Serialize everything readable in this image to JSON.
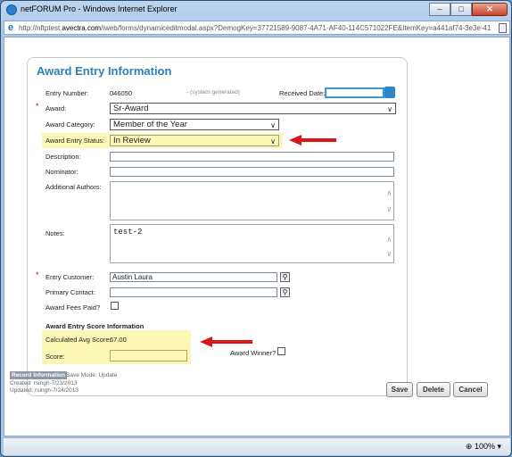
{
  "window": {
    "title": "netFORUM Pro - Windows Internet Explorer",
    "minimize": "–",
    "maximize": "□",
    "close": "✕"
  },
  "address": {
    "prefix": "http://nftptest.",
    "domain": "avectra.com",
    "path": "/iweb/forms/dynamiceditmodal.aspx?DemogKey=37721589-9087-4A71-AF40-114C571022FE&ItemKey=a441af74-3e3e-41"
  },
  "form": {
    "title": "Award Entry Information",
    "entry_number_label": "Entry Number:",
    "entry_number": "046050",
    "system_generated": "- (system generated)",
    "received_date_label": "Received Date:",
    "received_date": "",
    "award_label": "Award:",
    "award": "Sr-Award",
    "award_category_label": "Award Category:",
    "award_category": "Member of the Year",
    "status_label": "Award Entry Status:",
    "status": "In Review",
    "description_label": "Description:",
    "description": "",
    "nominator_label": "Nominator:",
    "nominator": "",
    "additional_authors_label": "Additional Authors:",
    "additional_authors": "",
    "notes_label": "Notes:",
    "notes": "test-2",
    "entry_customer_label": "Entry Customer:",
    "entry_customer": "Austin Laura",
    "primary_contact_label": "Primary Contact:",
    "primary_contact": "",
    "fees_paid_label": "Award Fees Paid?",
    "score_section_title": "Award Entry Score Information",
    "calc_avg_label": "Calculated Avg Score:",
    "calc_avg": "67.00",
    "score_label": "Score:",
    "score": "",
    "award_winner_label": "Award Winner?",
    "required_mark": "*"
  },
  "record": {
    "tag": "Record Information",
    "save_mode": "Save Mode: Update",
    "created": "Created: rsingh-7/23/2013",
    "updated": "Updated: rsingh-7/24/2013"
  },
  "buttons": {
    "save": "Save",
    "delete": "Delete",
    "cancel": "Cancel"
  },
  "status": {
    "zoom": "100%"
  },
  "colors": {
    "highlight": "#fbf8b6",
    "arrow": "#d81818",
    "title": "#2d7fb8"
  }
}
